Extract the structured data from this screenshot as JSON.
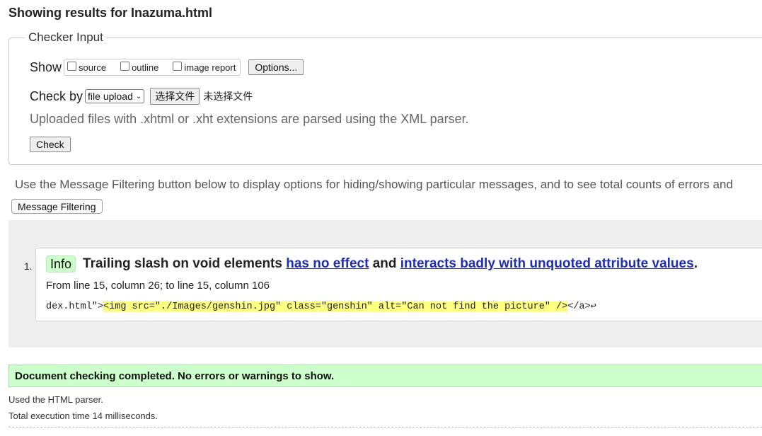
{
  "page": {
    "title": "Showing results for Inazuma.html"
  },
  "checker_input": {
    "legend": "Checker Input",
    "show_label": "Show",
    "show_options": [
      {
        "label": "source",
        "checked": false
      },
      {
        "label": "outline",
        "checked": false
      },
      {
        "label": "image report",
        "checked": false
      }
    ],
    "options_button": "Options...",
    "check_by_label": "Check by",
    "check_by_select_value": "file upload",
    "file_button": "选择文件",
    "file_status": "未选择文件",
    "parser_note": "Uploaded files with .xhtml or .xht extensions are parsed using the XML parser.",
    "check_button": "Check"
  },
  "filtering": {
    "note": "Use the Message Filtering button below to display options for hiding/showing particular messages, and to see total counts of errors and",
    "button": "Message Filtering"
  },
  "messages": [
    {
      "number": "1.",
      "type": "Info",
      "text_start": "Trailing slash on void elements",
      "link_1": "has no effect",
      "text_mid": "and",
      "link_2": "interacts badly with unquoted attribute values",
      "text_end": ".",
      "location": "From line 15, column 26; to line 15, column 106",
      "extract_before": "dex.html\">",
      "extract_highlight": "<img src=\"./Images/genshin.jpg\" class=\"genshin\" alt=\"Can not find the picture\" />",
      "extract_after": "</a>↩"
    }
  ],
  "summary": {
    "success": "Document checking completed. No errors or warnings to show.",
    "parser_used": "Used the HTML parser.",
    "execution_time": "Total execution time 14 milliseconds."
  },
  "colors": {
    "info_badge": "#ccffcc",
    "success_bar": "#ccffcc",
    "link": "#1f2db3",
    "highlight": "#ffff80",
    "results_panel": "#eeeeee"
  }
}
